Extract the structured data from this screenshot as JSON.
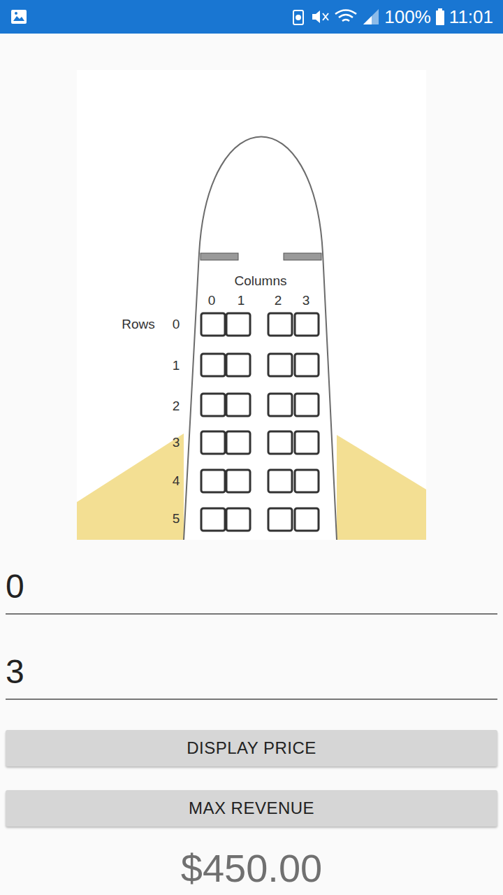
{
  "status_bar": {
    "battery": "100%",
    "time": "11:01"
  },
  "diagram": {
    "columns_label": "Columns",
    "column_numbers": [
      "0",
      "1",
      "2",
      "3"
    ],
    "rows_label": "Rows",
    "row_numbers": [
      "0",
      "1",
      "2",
      "3",
      "4",
      "5"
    ]
  },
  "fields": [
    {
      "value": "0"
    },
    {
      "value": "3"
    }
  ],
  "buttons": [
    "DISPLAY PRICE",
    "MAX REVENUE"
  ],
  "price": "$450.00"
}
